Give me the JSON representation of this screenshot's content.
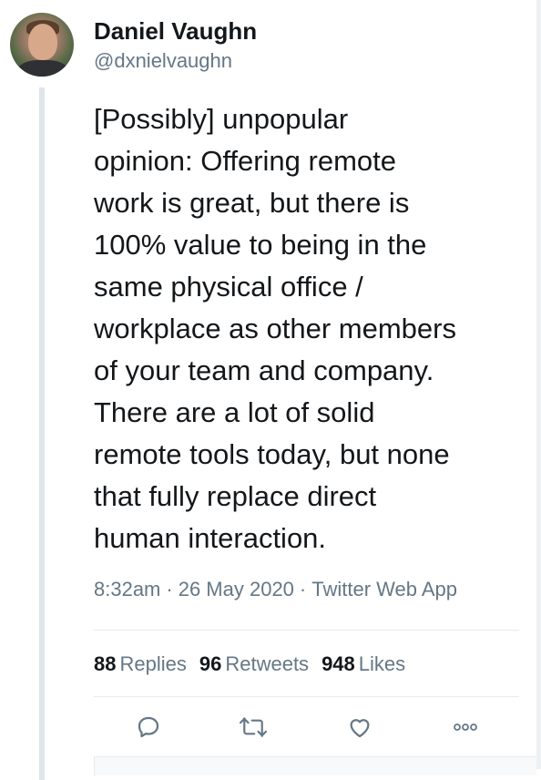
{
  "author": {
    "display_name": "Daniel Vaughn",
    "handle": "@dxnielvaughn"
  },
  "tweet": {
    "text": "[Possibly] unpopular\nopinion: Offering remote\nwork is great, but there is\n100% value to being in the\nsame physical office /\nworkplace as other members\nof your team and company.\nThere are a lot of solid\nremote tools today, but none\nthat fully replace direct\nhuman interaction.",
    "time": "8:32am",
    "separator": "·",
    "date": "26 May 2020",
    "source": "Twitter Web App"
  },
  "stats": {
    "replies_count": "88",
    "replies_label": "Replies",
    "retweets_count": "96",
    "retweets_label": "Retweets",
    "likes_count": "948",
    "likes_label": "Likes"
  },
  "actions": {
    "icons": [
      "reply-icon",
      "retweet-icon",
      "like-icon",
      "more-icon"
    ],
    "icon_color": "#657786"
  },
  "colors": {
    "text": "#14171a",
    "secondary": "#657786",
    "divider": "#e6ecf0",
    "thread_line": "#dfe5eb"
  }
}
